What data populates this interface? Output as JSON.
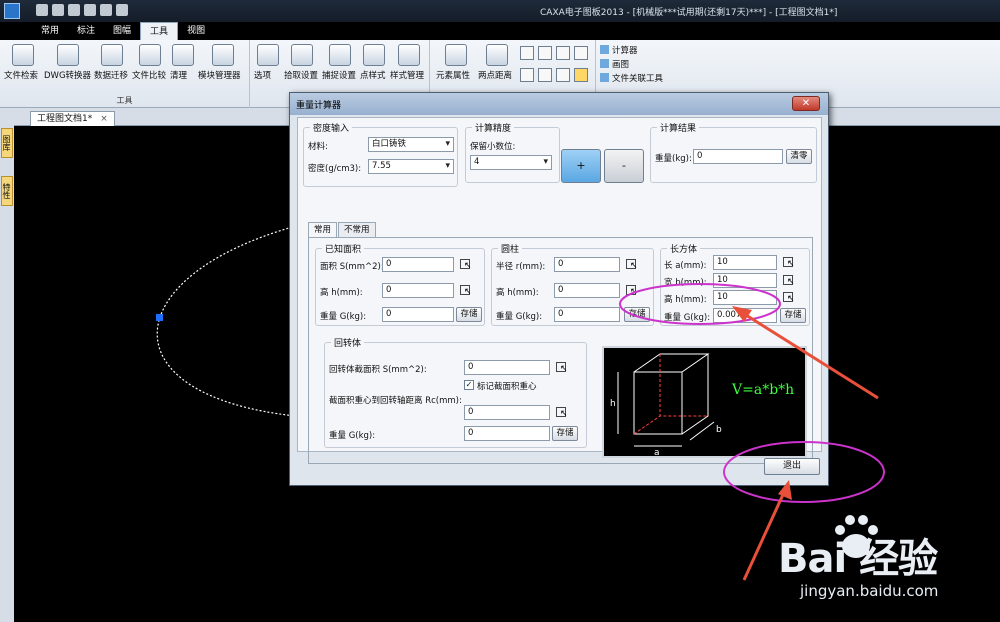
{
  "window": {
    "title": "CAXA电子图板2013 - [机械版***试用期(还剩17天)***] - [工程图文档1*]"
  },
  "ribbon": {
    "tabs": [
      "常用",
      "标注",
      "图幅",
      "工具",
      "视图"
    ],
    "active_tab": "工具",
    "tool_group_label": "工具",
    "tools": [
      "文件检索",
      "DWG转换器",
      "数据迁移",
      "文件比较",
      "清理",
      "模块管理器",
      "选项",
      "拾取设置",
      "捕捉设置",
      "点样式",
      "样式管理",
      "元素属性",
      "两点距离"
    ],
    "side_items": [
      "计算器",
      "画图",
      "文件关联工具"
    ]
  },
  "document": {
    "tab_label": "工程图文档1*",
    "close_glyph": "×"
  },
  "left_dock": [
    "图库",
    "特性"
  ],
  "dialog": {
    "title": "重量计算器",
    "close_glyph": "✕",
    "density_input": {
      "title": "密度输入",
      "material_label": "材料:",
      "material_value": "白口铸铁",
      "density_label": "密度(g/cm3):",
      "density_value": "7.55"
    },
    "precision": {
      "title": "计算精度",
      "decimals_label": "保留小数位:",
      "decimals_value": "4",
      "plus": "+",
      "minus": "-"
    },
    "result": {
      "title": "计算结果",
      "weight_label": "重量(kg):",
      "weight_value": "0",
      "clear_label": "清零"
    },
    "tabs": [
      "常用",
      "不常用"
    ],
    "known_area": {
      "title": "已知面积",
      "area_label": "面积 S(mm^2):",
      "area_value": "0",
      "height_label": "高 h(mm):",
      "height_value": "0",
      "weight_label": "重量 G(kg):",
      "weight_value": "0",
      "store_label": "存储"
    },
    "cylinder": {
      "title": "圆柱",
      "radius_label": "半径 r(mm):",
      "radius_value": "0",
      "height_label": "高 h(mm):",
      "height_value": "0",
      "weight_label": "重量 G(kg):",
      "weight_value": "0",
      "store_label": "存储"
    },
    "cuboid": {
      "title": "长方体",
      "length_label": "长 a(mm):",
      "length_value": "10",
      "width_label": "宽 b(mm):",
      "width_value": "10",
      "height_label": "高 h(mm):",
      "height_value": "10",
      "weight_label": "重量 G(kg):",
      "weight_value": "0.0076",
      "store_label": "存储"
    },
    "revolution": {
      "title": "回转体",
      "section_area_label": "回转体截面积 S(mm^2):",
      "section_area_value": "0",
      "mark_centroid_label": "标记截面积重心",
      "mark_centroid_checked": true,
      "centroid_distance_label": "截面积重心到回转轴距离 Rc(mm):",
      "centroid_distance_value": "0",
      "weight_label": "重量 G(kg):",
      "weight_value": "0",
      "store_label": "存储"
    },
    "preview": {
      "formula": "V=a*b*h",
      "dim_h": "h",
      "dim_a": "a",
      "dim_b": "b"
    },
    "exit_label": "退出"
  },
  "watermark": {
    "brand": "Bai 经验",
    "url": "jingyan.baidu.com"
  },
  "colors": {
    "highlight_ellipse": "#cc33cc",
    "arrow": "#e8503a",
    "formula_green": "#3cff3c",
    "plus_button": "#5aa7e3"
  }
}
